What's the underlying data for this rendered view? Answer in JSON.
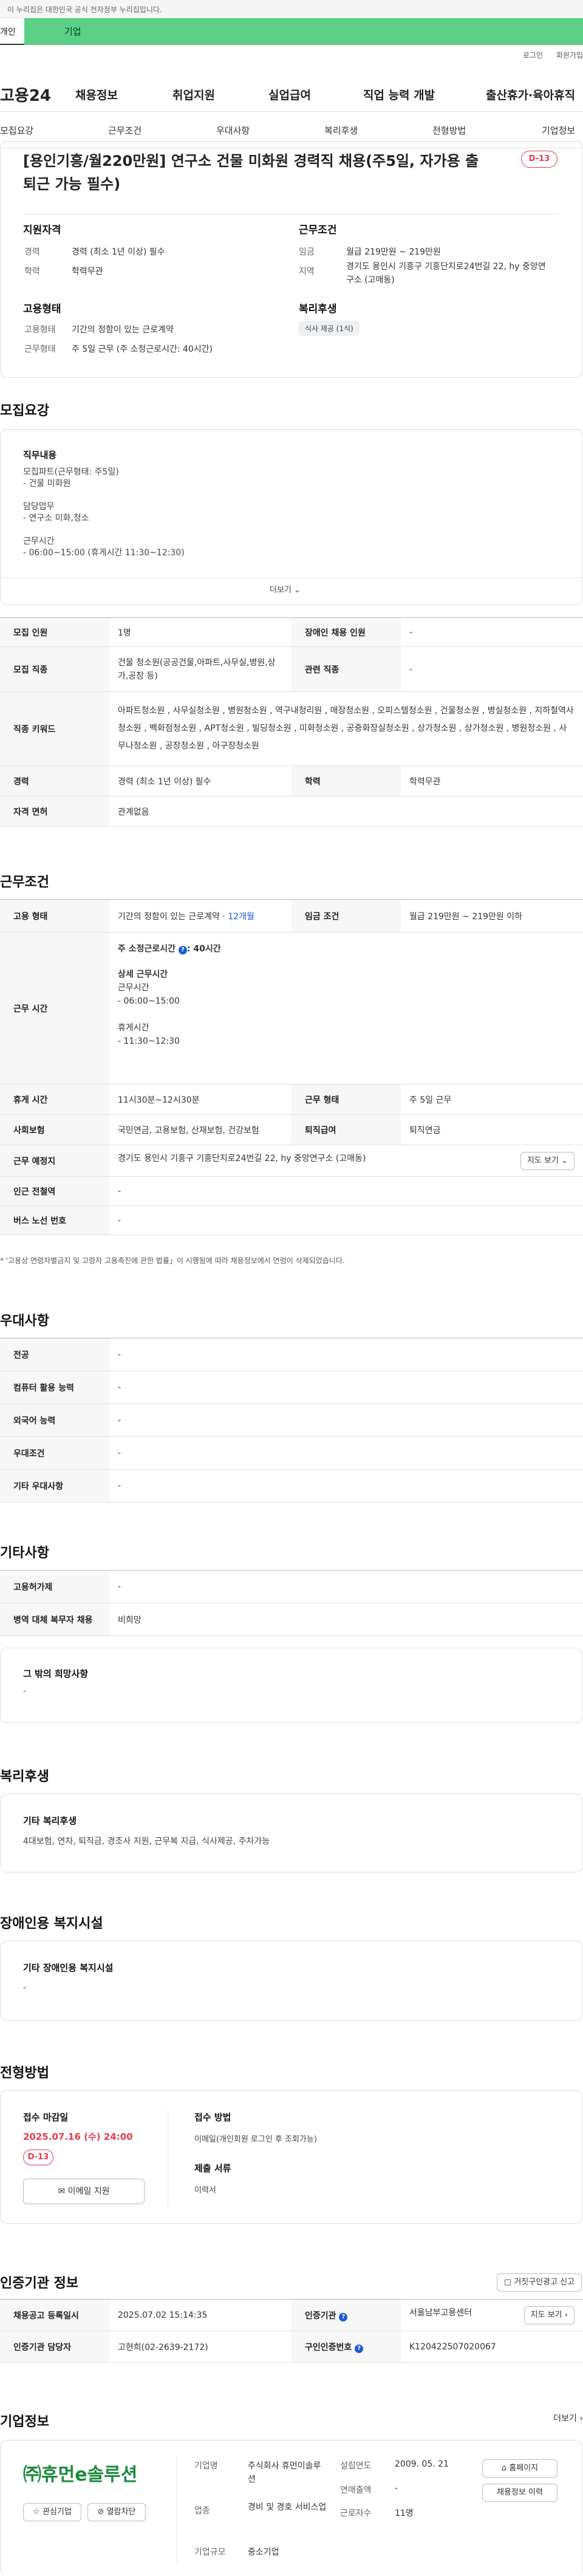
{
  "gov_notice": "이 누리집은 대한민국 공식 전자정부 누리집입니다.",
  "top_tabs": {
    "personal": "개인",
    "corporate": "기업"
  },
  "util": {
    "login": "로그인",
    "join": "회원가입"
  },
  "site": {
    "logo": "고용24"
  },
  "gnb": [
    "채용정보",
    "취업지원",
    "실업급여",
    "직업 능력 개발",
    "출산휴가·육아휴직"
  ],
  "subnav": [
    "모집요강",
    "근무조건",
    "우대사항",
    "복리후생",
    "전형방법",
    "기업정보"
  ],
  "summary": {
    "title": "[용인기흥/월220만원] 연구소 건물 미화원 경력직 채용(주5일, 자가용 출퇴근 가능 필수)",
    "dday": "D-13",
    "qual_h": "지원자격",
    "cond_h": "근무조건",
    "career_l": "경력",
    "career_v": "경력 (최소 1년 이상) 필수",
    "edu_l": "학력",
    "edu_v": "학력무관",
    "wage_l": "임금",
    "wage_v": "월급 219만원 ~ 219만원",
    "region_l": "지역",
    "region_v": "경기도 용인시 기흥구 기흥단지로24번길 22, hy 중앙연구소 (고매동)",
    "emp_h": "고용형태",
    "welfare_h": "복리후생",
    "emptype_l": "고용형태",
    "emptype_v": "기간의 정함이 있는 근로계약",
    "worktype_l": "근무형태",
    "worktype_v": "주 5일 근무 (주 소정근로시간: 40시간)",
    "welfare_chip": "식사 제공 (1식)"
  },
  "recruit": {
    "h": "모집요강",
    "duty_h": "직무내용",
    "duty_lines": [
      "모집파트(근무형태: 주5일)",
      "- 건물 미화원",
      "",
      "담당업무",
      "- 연구소 미화,청소",
      "",
      "근무시간",
      "- 06:00~15:00 (휴게시간 11:30~12:30)"
    ],
    "more": "더보기",
    "rows": {
      "cnt_h": "모집 인원",
      "cnt_v": "1명",
      "dis_h": "장애인 채용 인원",
      "dis_v": "-",
      "job_h": "모집 직종",
      "job_v": "건물 청소원(공공건물,아파트,사무실,병원,상가,공장 등)",
      "rel_h": "관련 직종",
      "rel_v": "-",
      "kw_h": "직종 키워드",
      "kw_v": "아파트청소원 , 사무실청소원 , 병원청소원 , 역구내청리원 , 매장청소원 , 오피스텔청소원 , 건물청소원 , 병실청소원 , 지하철역사청소원 , 백화점청소원 , APT청소원 , 빌딩청소원 , 미화청소원 , 공중화장실청소원 , 상가청소원 , 상가청소원 , 병원청소원 , 사무나청소원 , 공장청소원 , 아구장청소원",
      "car_h": "경력",
      "car_v": "경력 (최소 1년 이상) 필수",
      "edu_h": "학력",
      "edu_v": "학력무관",
      "lic_h": "자격 면허",
      "lic_v": "관계없음"
    }
  },
  "cond": {
    "h": "근무조건",
    "emp_h": "고용 형태",
    "emp_v": "기간의 정함이 있는 근로계약 · ",
    "emp_v2": "12개월",
    "wage_h": "임금 조건",
    "wage_v": "월급 219만원 ~ 219만원 이하",
    "time_h": "근무 시간",
    "time_main": "주 소정근로시간",
    "time_main2": ": 40시간",
    "time_lines": [
      "상세 근무시간",
      "근무시간",
      "- 06:00~15:00",
      "",
      "휴게시간",
      "- 11:30~12:30"
    ],
    "rest_h": "휴게 시간",
    "rest_v": "11시30분~12시30분",
    "form_h": "근무 형태",
    "form_v": "주 5일 근무",
    "ins_h": "사회보험",
    "ins_v": "국민연금, 고용보험, 산재보험, 건강보험",
    "ret_h": "퇴직급여",
    "ret_v": "퇴직연금",
    "addr_h": "근무 예정지",
    "addr_v": "경기도 용인시 기흥구 기흥단지로24번길 22, hy 중앙연구소 (고매동)",
    "map_btn": "지도 보기",
    "sub_h": "인근 전철역",
    "sub_v": "-",
    "bus_h": "버스 노선 번호",
    "bus_v": "-",
    "note": "* '고용상 연령차별금지 및 고령자 고용촉진에 관한 법률」이 시행됨에 따라 채용정보에서 연령이 삭제되었습니다."
  },
  "pref": {
    "h": "우대사항",
    "rows": [
      [
        "전공",
        "-"
      ],
      [
        "컴퓨터 활용 능력",
        "-"
      ],
      [
        "외국어 능력",
        "-"
      ],
      [
        "우대조건",
        "-"
      ],
      [
        "기타 우대사항",
        "-"
      ]
    ]
  },
  "etc": {
    "h": "기타사항",
    "rows": [
      [
        "고용허가제",
        "-"
      ],
      [
        "병역 대체 복무자 채용",
        "비희망"
      ]
    ],
    "other_h": "그 밖의 희망사항",
    "other_v": "-"
  },
  "welfare": {
    "h": "복리후생",
    "sub_h": "기타 복리후생",
    "v": "4대보험, 연차, 퇴직금, 경조사 지원, 근무복 지급, 식사제공, 주차가능"
  },
  "disab": {
    "h": "장애인용 복지시설",
    "sub_h": "기타 장애인용 복지시설",
    "v": "-"
  },
  "process": {
    "h": "전형방법",
    "deadline_h": "접수 마감일",
    "deadline_v": "2025.07.16 (수) 24:00",
    "dday": "D-13",
    "email_btn": "이메일 지원",
    "method_h": "접수 방법",
    "method_v": "이메일(개인회원 로그인 후 조회가능)",
    "docs_h": "제출 서류",
    "docs_v": "이력서"
  },
  "agency": {
    "h": "인증기관 정보",
    "report_btn": "거짓구인광고 신고",
    "reg_h": "채용공고 등록일시",
    "reg_v": "2025.07.02 15:14:35",
    "org_h": "인증기관",
    "org_v": "서울남부고용센터",
    "map_btn": "지도 보기",
    "mgr_h": "인증기관 담당자",
    "mgr_v": "고현희(02-2639-2172)",
    "num_h": "구인인증번호",
    "num_v": "K120422507020067"
  },
  "company": {
    "h": "기업정보",
    "more": "더보기",
    "logo": "㈜휴먼e솔루션",
    "fav_btn": "관심기업",
    "block_btn": "열람차단",
    "name_h": "기업명",
    "name_v": "주식회사 휴먼이솔루션",
    "est_h": "설립연도",
    "est_v": "2009. 05. 21",
    "ind_h": "업종",
    "ind_v": "경비 및 경호 서비스업",
    "sales_h": "연매출액",
    "sales_v": "-",
    "emp_h": "근로자수",
    "emp_v": "11명",
    "size_h": "기업규모",
    "size_v": "중소기업",
    "home_btn": "홈페이지",
    "jobs_btn": "채용정보 이력"
  },
  "colors": {
    "accent_green": "#5bcf84",
    "dday_red": "#e53b4e",
    "link_blue": "#1a5bd6"
  }
}
